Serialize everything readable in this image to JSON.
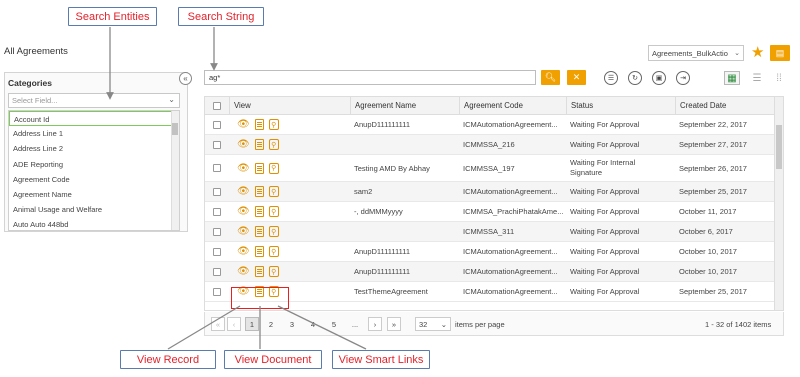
{
  "callouts": {
    "search_entities": "Search Entities",
    "search_string": "Search String",
    "view_record": "View Record",
    "view_document": "View Document",
    "view_smart_links": "View Smart Links"
  },
  "page": {
    "title": "All Agreements"
  },
  "categories": {
    "label": "Categories",
    "select_placeholder": "Select Field...",
    "fields": [
      "Account Id",
      "Address Line 1",
      "Address Line 2",
      "ADE Reporting",
      "Agreement Code",
      "Agreement Name",
      "Animal Usage and Welfare",
      "Auto Auto 448bd"
    ],
    "selected_field": "Account Id"
  },
  "search": {
    "value": "ag*"
  },
  "toolbar": {
    "view_select": "Agreements_BulkActio"
  },
  "table": {
    "columns": [
      "View",
      "Agreement Name",
      "Agreement Code",
      "Status",
      "Created Date"
    ],
    "rows": [
      {
        "name": "AnupD111111111",
        "code": "ICMAutomationAgreement...",
        "status": "Waiting For Approval",
        "date": "September 22, 2017"
      },
      {
        "name": "",
        "code": "ICMMSSA_216",
        "status": "Waiting For Approval",
        "date": "September 27, 2017"
      },
      {
        "name": "Testing AMD By Abhay",
        "code": "ICMMSSA_197",
        "status": "Waiting For Internal Signature",
        "date": "September 26, 2017"
      },
      {
        "name": "sam2",
        "code": "ICMAutomationAgreement...",
        "status": "Waiting For Approval",
        "date": "September 25, 2017"
      },
      {
        "name": "-, ddMMMyyyy",
        "code": "ICMMSA_PrachiPhatakAme...",
        "status": "Waiting For Approval",
        "date": "October 11, 2017"
      },
      {
        "name": "",
        "code": "ICMMSSA_311",
        "status": "Waiting For Approval",
        "date": "October 6, 2017"
      },
      {
        "name": "AnupD111111111",
        "code": "ICMAutomationAgreement...",
        "status": "Waiting For Approval",
        "date": "October 10, 2017"
      },
      {
        "name": "AnupD111111111",
        "code": "ICMAutomationAgreement...",
        "status": "Waiting For Approval",
        "date": "October 10, 2017"
      },
      {
        "name": "TestThemeAgreement",
        "code": "ICMAutomationAgreement...",
        "status": "Waiting For Approval",
        "date": "September 25, 2017"
      }
    ]
  },
  "pagination": {
    "first": "«",
    "prev": "‹",
    "pages": [
      "1",
      "2",
      "3",
      "4",
      "5",
      "..."
    ],
    "current_page": "1",
    "next": "›",
    "last": "»",
    "page_size": "32",
    "items_per_page_label": "items per page",
    "range_text": "1 - 32 of 1402 items"
  }
}
